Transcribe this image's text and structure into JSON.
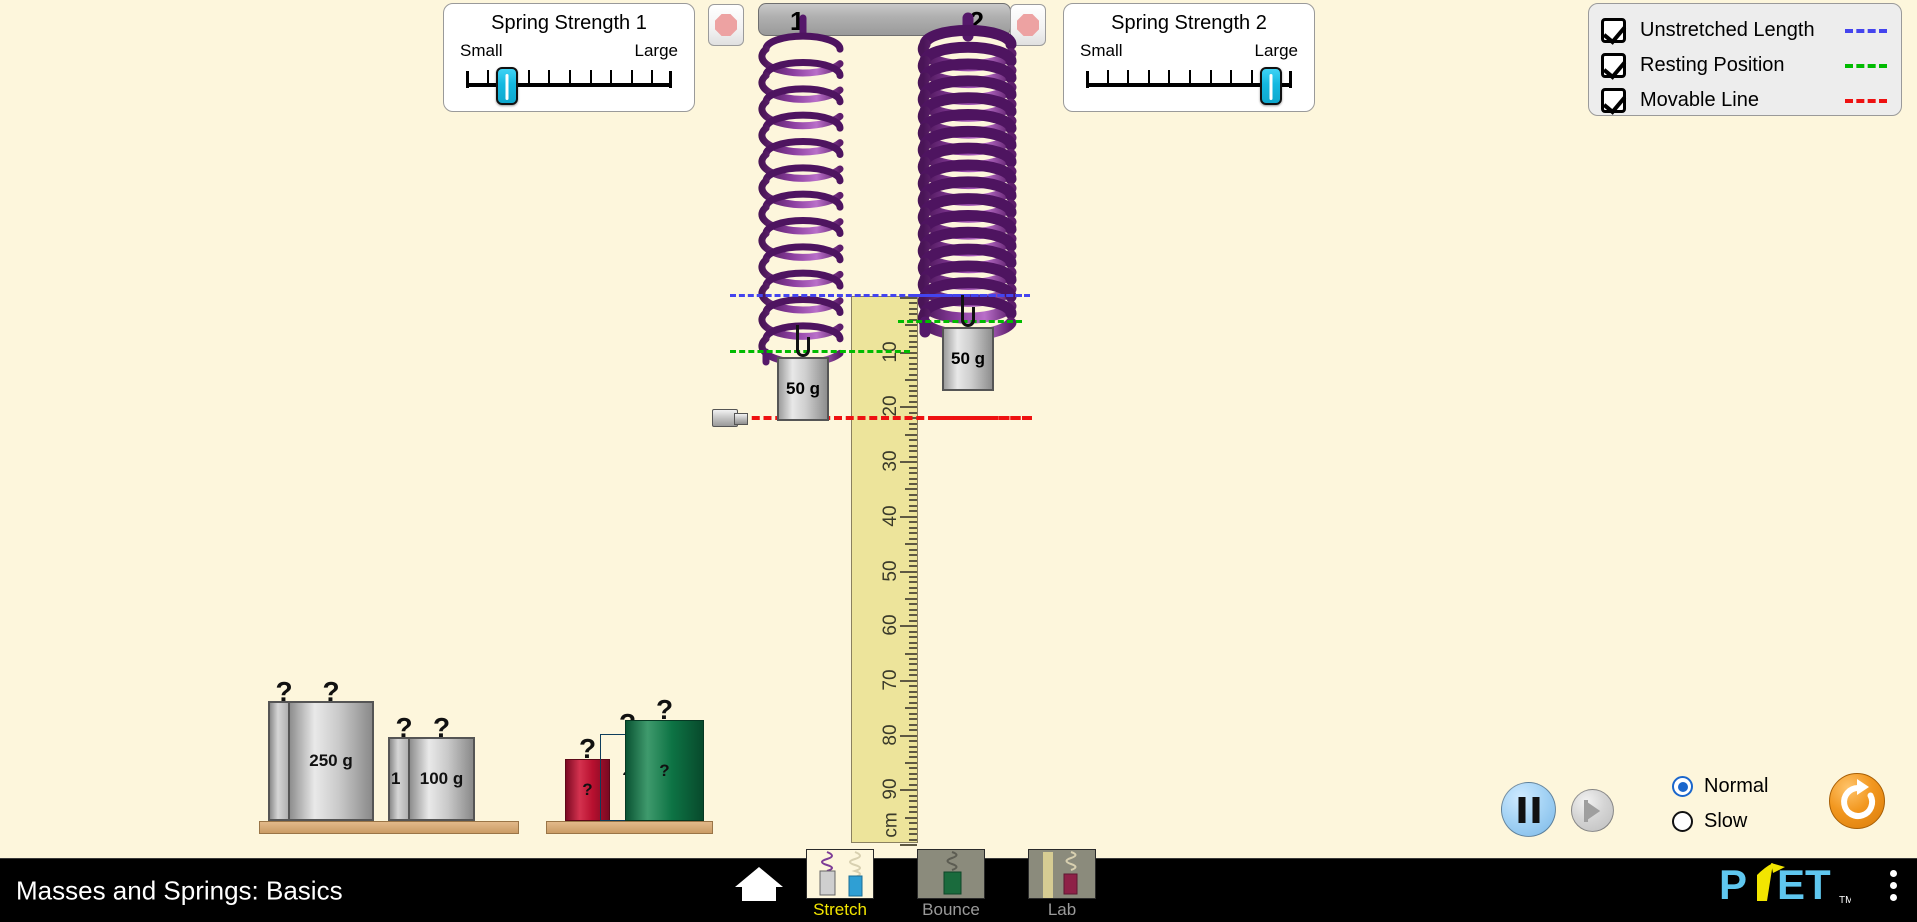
{
  "app": {
    "title": "Masses and Springs: Basics",
    "background_color": "#FDF6DC"
  },
  "spring_strength_1": {
    "title": "Spring Strength 1",
    "min_label": "Small",
    "max_label": "Large",
    "value_fraction": 0.2,
    "tick_count": 10
  },
  "spring_strength_2": {
    "title": "Spring Strength 2",
    "min_label": "Small",
    "max_label": "Large",
    "value_fraction": 0.9,
    "tick_count": 10
  },
  "ceiling": {
    "spring_1_number": "1",
    "spring_2_number": "2"
  },
  "stop_buttons": {
    "spring_1_name": "stop-spring-1",
    "spring_2_name": "stop-spring-2",
    "icon": "octagon-stop-icon",
    "color": "#EDA2A2"
  },
  "legend": {
    "items": [
      {
        "label": "Unstretched Length",
        "checked": true,
        "color": "#4444ee"
      },
      {
        "label": "Resting Position",
        "checked": true,
        "color": "#00bb00"
      },
      {
        "label": "Movable Line",
        "checked": true,
        "color": "#ee1111"
      }
    ]
  },
  "ruler": {
    "unit_label": "cm",
    "tick_labels": [
      "10",
      "20",
      "30",
      "40",
      "50",
      "60",
      "70",
      "80",
      "90"
    ],
    "major_interval_cm": 10,
    "max_cm": 100
  },
  "hanging_masses": [
    {
      "label": "50 g",
      "spring": "1"
    },
    {
      "label": "50 g",
      "spring": "2"
    }
  ],
  "shelf_masses_grey": [
    {
      "label": "250 g",
      "hooks": "??",
      "hidden_behind": true
    },
    {
      "label": "100 g",
      "prefix": "1",
      "hooks": "??",
      "hidden_behind": true
    }
  ],
  "shelf_masses_color": [
    {
      "label": "?",
      "color": "#B0102F"
    },
    {
      "label": "?",
      "color": "#1C72AC"
    },
    {
      "label": "?",
      "color": "#0C7244"
    }
  ],
  "sim_controls": {
    "pause_name": "pause-button",
    "pause_active": true,
    "step_name": "step-forward-button",
    "step_enabled": false,
    "speed_options": [
      {
        "label": "Normal",
        "selected": true
      },
      {
        "label": "Slow",
        "selected": false
      }
    ],
    "reset_label": "Reset All"
  },
  "nav": {
    "home_icon": "home-icon",
    "tabs": [
      {
        "label": "Stretch",
        "selected": true
      },
      {
        "label": "Bounce",
        "selected": false
      },
      {
        "label": "Lab",
        "selected": false
      }
    ],
    "logo": "PhET",
    "logo_tm": "TM",
    "menu_icon": "kebab-menu-icon"
  }
}
